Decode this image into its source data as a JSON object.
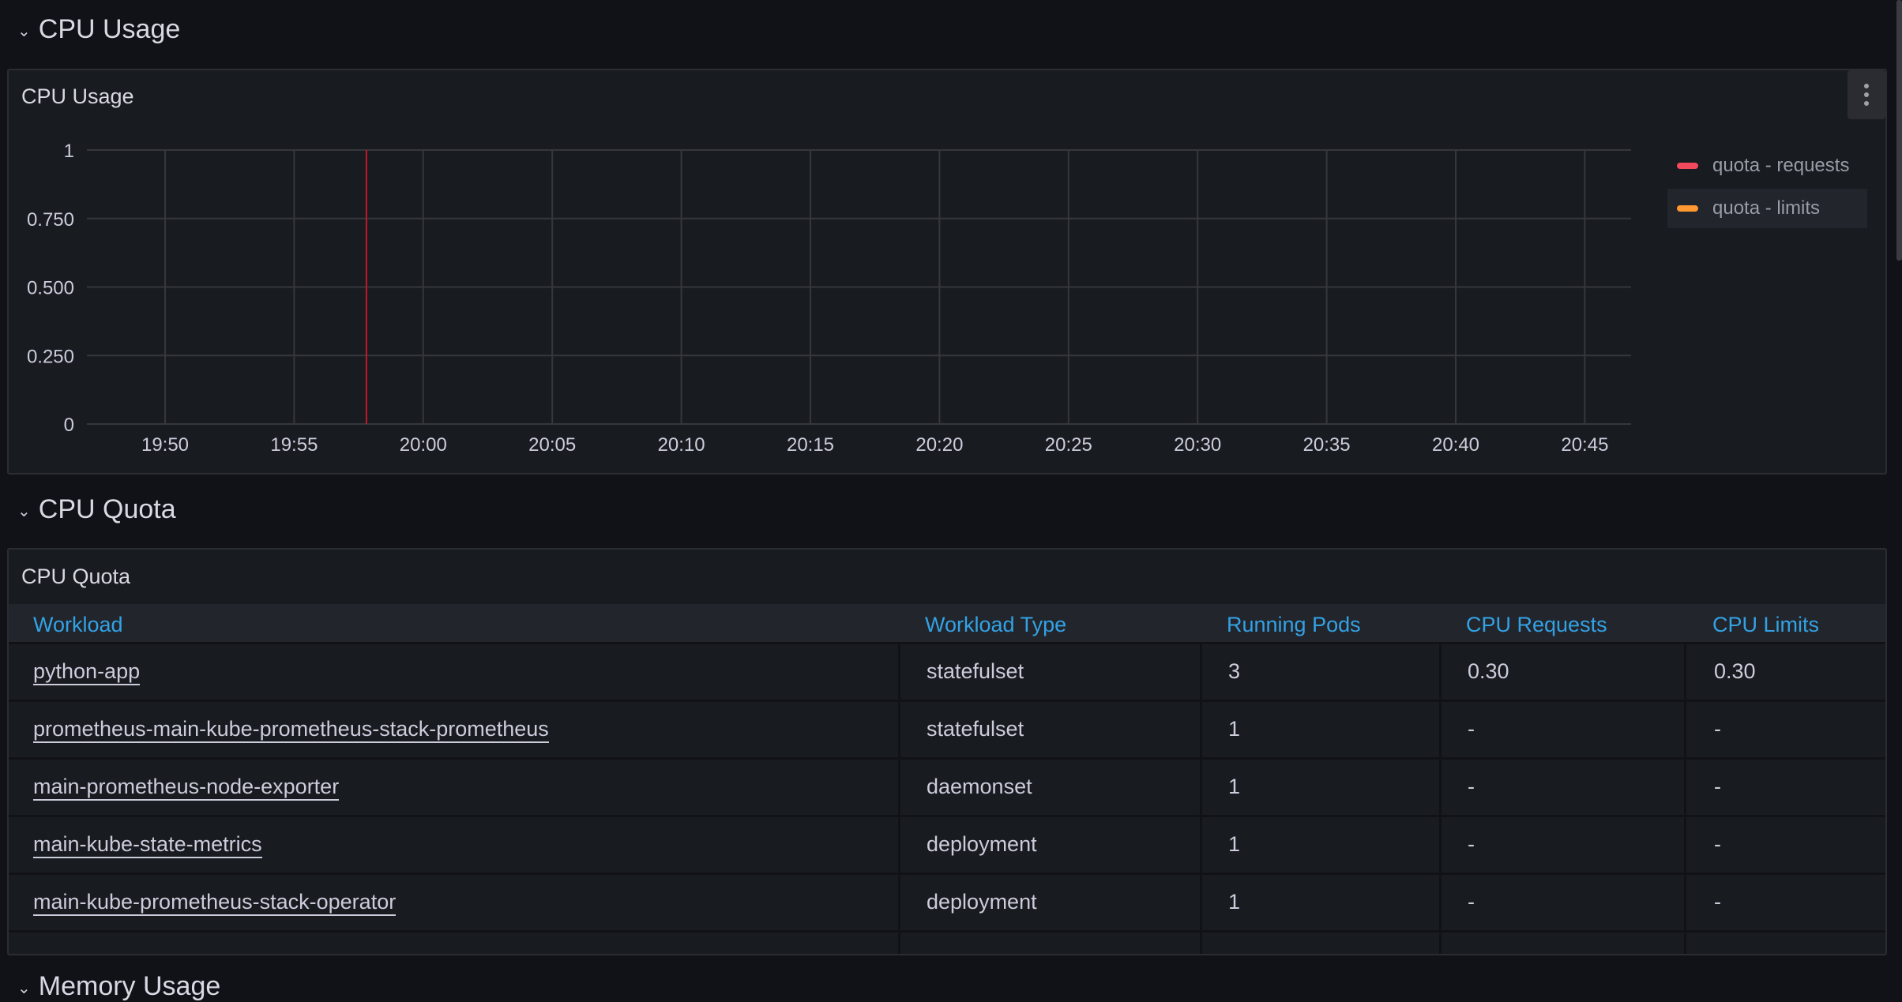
{
  "rows": [
    {
      "title": "CPU Usage"
    },
    {
      "title": "CPU Quota"
    },
    {
      "title": "Memory Usage"
    }
  ],
  "cpu_usage_panel": {
    "title": "CPU Usage",
    "menu_icon": "kebab-menu-icon"
  },
  "chart_data": {
    "type": "line",
    "title": "CPU Usage",
    "xlabel": "",
    "ylabel": "",
    "x_ticks": [
      "19:50",
      "19:55",
      "20:00",
      "20:05",
      "20:10",
      "20:15",
      "20:20",
      "20:25",
      "20:30",
      "20:35",
      "20:40",
      "20:45"
    ],
    "y_ticks": [
      "0",
      "0.250",
      "0.500",
      "0.750",
      "1"
    ],
    "y_tick_values": [
      0,
      0.25,
      0.5,
      0.75,
      1
    ],
    "ylim": [
      0,
      1
    ],
    "grid": true,
    "annotation_time_minutes_after_1950": 7.8,
    "annotation_color": "#c4162a",
    "legend_position": "right",
    "series": [
      {
        "name": "quota - requests",
        "color": "#f2495c",
        "values": []
      },
      {
        "name": "quota - limits",
        "color": "#ff9830",
        "values": []
      }
    ]
  },
  "cpu_quota_panel": {
    "title": "CPU Quota",
    "columns": [
      "Workload",
      "Workload Type",
      "Running Pods",
      "CPU Requests",
      "CPU Limits"
    ],
    "rows": [
      [
        "python-app",
        "statefulset",
        "3",
        "0.30",
        "0.30"
      ],
      [
        "prometheus-main-kube-prometheus-stack-prometheus",
        "statefulset",
        "1",
        "-",
        "-"
      ],
      [
        "main-prometheus-node-exporter",
        "daemonset",
        "1",
        "-",
        "-"
      ],
      [
        "main-kube-state-metrics",
        "deployment",
        "1",
        "-",
        "-"
      ],
      [
        "main-kube-prometheus-stack-operator",
        "deployment",
        "1",
        "-",
        "-"
      ]
    ]
  },
  "colors": {
    "header_link": "#33a2e5",
    "background": "#111217",
    "panel": "#181b1f"
  }
}
